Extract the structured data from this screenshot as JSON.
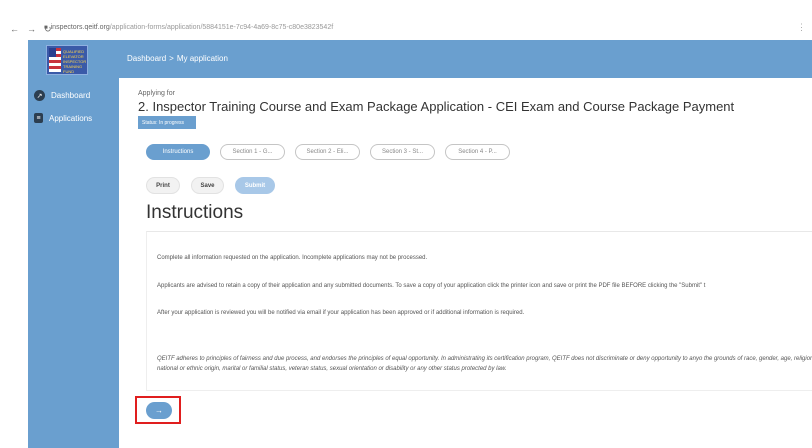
{
  "browser": {
    "url_host": "inspectors.qeitf.org",
    "url_path": "/application-forms/application/5884151e-7c94-4a69-8c75-c80e3823542f"
  },
  "header": {
    "logo_text": "QUALIFIED ELEVATOR INSPECTOR TRAINING FUND",
    "breadcrumb": [
      "Dashboard",
      "My application"
    ],
    "breadcrumb_sep": ">"
  },
  "sidebar": {
    "items": [
      {
        "label": "Dashboard",
        "icon": "trend-icon"
      },
      {
        "label": "Applications",
        "icon": "document-icon"
      }
    ]
  },
  "main": {
    "applying_label": "Applying for",
    "title": "2. Inspector Training Course and Exam Package Application - CEI Exam and Course Package Payment",
    "status_label": "Status: ",
    "status_value": "In progress",
    "tabs": [
      {
        "label": "Instructions",
        "active": true
      },
      {
        "label": "Section 1 - G...",
        "active": false
      },
      {
        "label": "Section 2 - Eli...",
        "active": false
      },
      {
        "label": "Section 3 - St...",
        "active": false
      },
      {
        "label": "Section 4 - P...",
        "active": false
      }
    ],
    "actions": {
      "print": "Print",
      "save": "Save",
      "submit": "Submit"
    },
    "section_heading": "Instructions",
    "paragraphs": [
      "Complete all information requested on the application. Incomplete applications may not be processed.",
      "Applicants are advised to retain a copy of their application and any submitted documents. To save a copy of your application click the printer icon and save or print the PDF file BEFORE clicking the \"Submit\" t",
      "After your application is reviewed you will be notified via email if your application has been approved or if additional information is required.",
      "QEITF adheres to principles of fairness and due process, and endorses the principles of equal opportunity. In administrating its certification program, QEITF does not discriminate or deny opportunity to anyo the grounds of race, gender, age, religion, national or ethnic origin, marital or familial status, veteran status, sexual orientation or disability or any other status protected by law."
    ],
    "next_icon": "arrow-right-icon"
  },
  "colors": {
    "primary": "#6a9fcf",
    "highlight": "#e01e1e"
  }
}
